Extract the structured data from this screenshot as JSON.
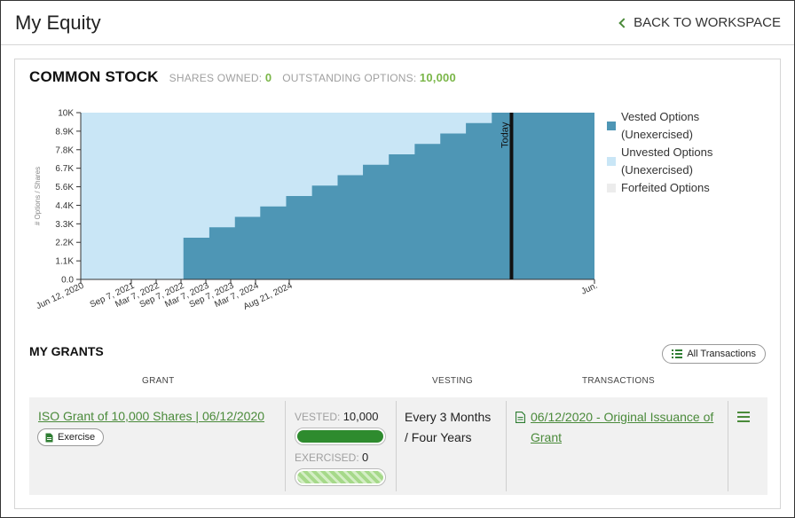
{
  "header": {
    "title": "My Equity",
    "back_label": "BACK TO WORKSPACE"
  },
  "stock": {
    "title": "COMMON STOCK",
    "shares_owned_label": "SHARES OWNED:",
    "shares_owned_value": "0",
    "outstanding_label": "OUTSTANDING OPTIONS:",
    "outstanding_value": "10,000"
  },
  "colors": {
    "vested": "#4e96b5",
    "unvested": "#c9e6f6",
    "forfeited": "#ececec",
    "accent": "#4a8a3a",
    "stat_value": "#7ab648",
    "bar_green": "#2e8b2e",
    "bar_light": "#a6d98a"
  },
  "chart_data": {
    "type": "area",
    "y_label": "# Options / Shares",
    "y_ticks": [
      "0.0",
      "1.1K",
      "2.2K",
      "3.3K",
      "4.4K",
      "5.6K",
      "6.7K",
      "7.8K",
      "8.9K",
      "10K"
    ],
    "y_range": [
      0,
      10000
    ],
    "x_tick_labels": [
      "Jun 12, 2020",
      "Sep 7, 2021",
      "Mar 7, 2022",
      "Sep 7, 2022",
      "Mar 7, 2023",
      "Sep 7, 2023",
      "Mar 7, 2024",
      "Aug 21, 2024",
      "Jun."
    ],
    "x_range": [
      "2020-06-12",
      "2025-06-12"
    ],
    "today_date": "2024-08-21",
    "today_label": "Today",
    "series": [
      {
        "name": "Vested Options (Unexercised)",
        "type": "step",
        "points": [
          [
            "2020-06-12",
            0
          ],
          [
            "2021-06-12",
            0
          ],
          [
            "2021-06-12",
            2500
          ],
          [
            "2021-09-12",
            3125
          ],
          [
            "2021-12-12",
            3750
          ],
          [
            "2022-03-12",
            4375
          ],
          [
            "2022-06-12",
            5000
          ],
          [
            "2022-09-12",
            5625
          ],
          [
            "2022-12-12",
            6250
          ],
          [
            "2023-03-12",
            6875
          ],
          [
            "2023-06-12",
            7500
          ],
          [
            "2023-09-12",
            8125
          ],
          [
            "2023-12-12",
            8750
          ],
          [
            "2024-03-12",
            9375
          ],
          [
            "2024-06-12",
            10000
          ],
          [
            "2025-06-12",
            10000
          ]
        ]
      },
      {
        "name": "Unvested Options (Unexercised)",
        "total": 10000
      },
      {
        "name": "Forfeited Options",
        "total": 0
      }
    ],
    "legend": [
      {
        "line1": "Vested Options",
        "line2": "(Unexercised)",
        "key": "vested"
      },
      {
        "line1": "Unvested Options",
        "line2": "(Unexercised)",
        "key": "unvested"
      },
      {
        "line1": "Forfeited Options",
        "line2": "",
        "key": "forfeited"
      }
    ]
  },
  "grants": {
    "title": "MY GRANTS",
    "all_tx_label": "All Transactions",
    "columns": {
      "grant": "GRANT",
      "vesting": "VESTING",
      "transactions": "TRANSACTIONS"
    },
    "rows": [
      {
        "name": "ISO Grant of 10,000 Shares | 06/12/2020",
        "exercise_label": "Exercise",
        "vested_label": "VESTED:",
        "vested_value": "10,000",
        "vested_fraction": 1.0,
        "exercised_label": "EXERCISED:",
        "exercised_value": "0",
        "exercised_fraction": 0.0,
        "vesting_line1": "Every 3 Months",
        "vesting_line2": "/ Four Years",
        "transaction": "06/12/2020 - Original Issuance of Grant"
      }
    ]
  }
}
